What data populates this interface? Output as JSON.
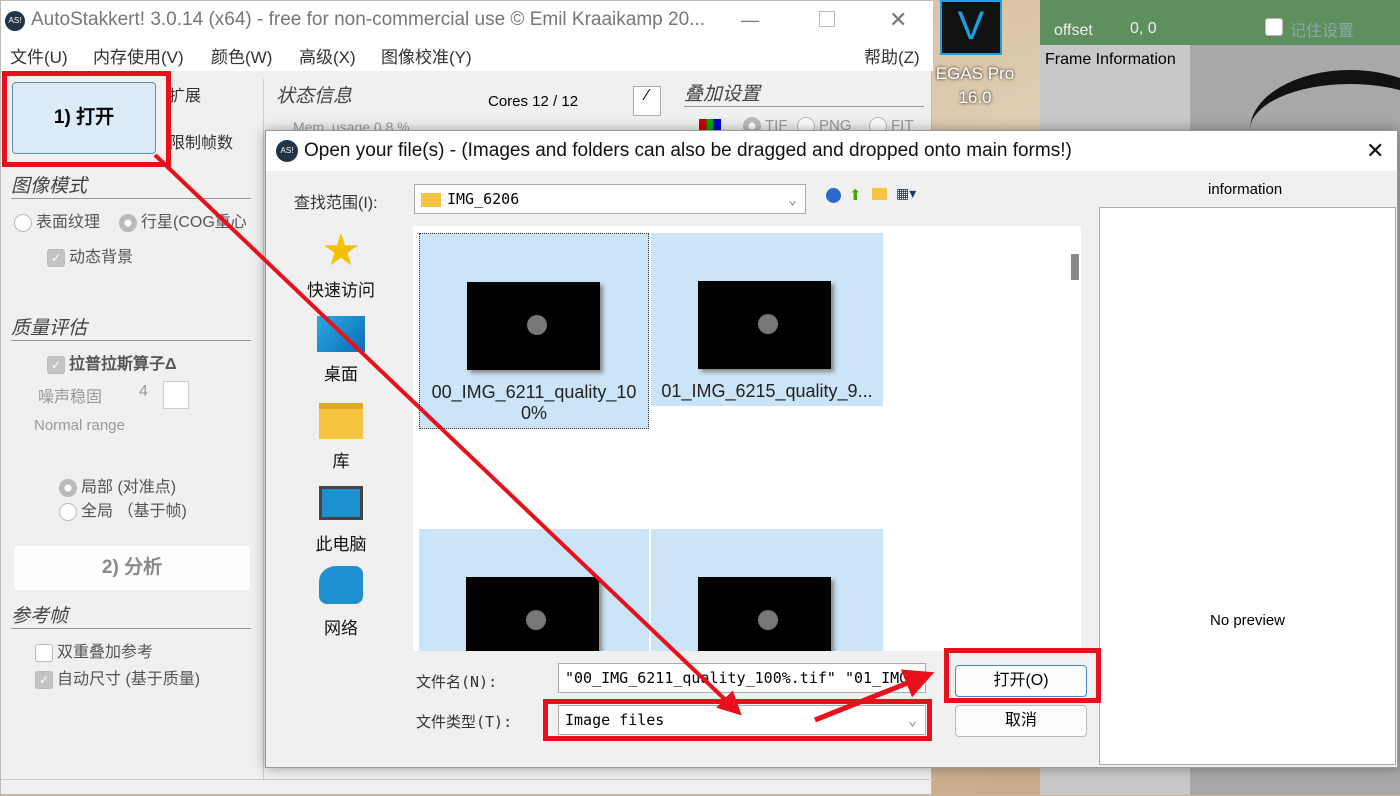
{
  "main_window": {
    "title": "AutoStakkert! 3.0.14 (x64) - free for non-commercial use © Emil Kraaikamp 20...",
    "menu": [
      "文件(U)",
      "内存使用(V)",
      "颜色(W)",
      "高级(X)",
      "图像校准(Y)",
      "帮助(Z)"
    ],
    "open_button": "1) 打开",
    "expand": "扩展",
    "limit_frames": "限制帧数",
    "status_header": "状态信息",
    "cores": "Cores 12 / 12",
    "mem_usage": "Mem. usage 0.8 %",
    "stack_settings_header": "叠加设置",
    "formats": [
      "TIF",
      "PNG",
      "FIT"
    ],
    "image_mode_header": "图像模式",
    "surface": "表面纹理",
    "planet": "行星(COG重心",
    "dynamic_bg": "动态背景",
    "quality_header": "质量评估",
    "laplace": "拉普拉斯算子Δ",
    "noise_robust": "噪声稳固",
    "noise_value": "4",
    "normal_range": "Normal range",
    "local": "局部 (对准点)",
    "global": "全局 （基于帧)",
    "analyze_button": "2) 分析",
    "reference_header": "参考帧",
    "double_stack": "双重叠加参考",
    "auto_size": "自动尺寸 (基于质量)"
  },
  "background": {
    "vegas": "EGAS Pro\n16.0",
    "vegas_line1": "EGAS Pro",
    "vegas_line2": "16.0",
    "offset_label": "offset",
    "offset_value": "0, 0",
    "remember": "记住设置",
    "frame_info": "Frame Information"
  },
  "dialog": {
    "title": "Open your file(s)  -  (Images and folders can also be dragged and dropped onto main forms!)",
    "lookin_label": "查找范围(I):",
    "lookin_value": "IMG_6206",
    "places": [
      "快速访问",
      "桌面",
      "库",
      "此电脑",
      "网络"
    ],
    "files": [
      "00_IMG_6211_quality_100%",
      "01_IMG_6215_quality_9...",
      "",
      ""
    ],
    "filename_label": "文件名(N):",
    "filename_value": "\"00_IMG_6211_quality_100%.tif\" \"01_IMG",
    "filetype_label": "文件类型(T):",
    "filetype_value": "Image files",
    "open_button": "打开(O)",
    "cancel_button": "取消",
    "info_label": "information",
    "no_preview": "No preview"
  },
  "annotation_color": "#e8101a"
}
